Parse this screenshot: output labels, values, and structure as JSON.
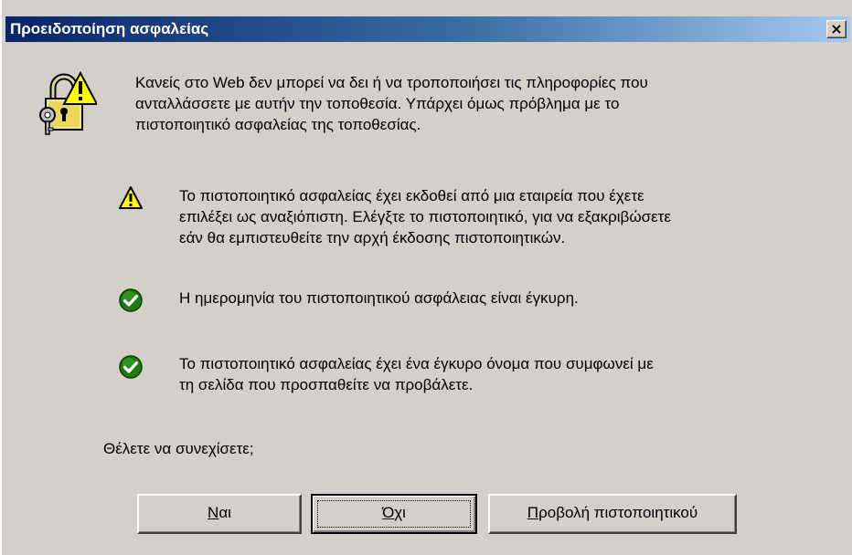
{
  "window": {
    "title": "Προειδοποίηση ασφαλείας",
    "close_glyph": "×"
  },
  "intro": {
    "line1": "Κανείς στο Web δεν μπορεί να δει ή να τροποποιήσει τις πληροφορίες που",
    "line2": "ανταλλάσσετε με αυτήν την τοποθεσία. Υπάρχει όμως πρόβλημα με το",
    "line3": "πιστοποιητικό ασφαλείας της τοποθεσίας."
  },
  "checks": [
    {
      "status": "warning",
      "icon": "warning-triangle-icon",
      "lines": [
        "Το πιστοποιητικό ασφαλείας έχει εκδοθεί από μια εταιρεία που έχετε",
        "επιλέξει ως αναξιόπιστη. Ελέγξτε το πιστοποιητικό, για να εξακριβώσετε",
        "εάν θα εμπιστευθείτε την αρχή έκδοσης πιστοποιητικών."
      ]
    },
    {
      "status": "ok",
      "icon": "checkmark-circle-icon",
      "lines": [
        "Η ημερομηνία του πιστοποιητικού ασφάλειας είναι έγκυρη."
      ]
    },
    {
      "status": "ok",
      "icon": "checkmark-circle-icon",
      "lines": [
        "Το πιστοποιητικό ασφαλείας έχει ένα έγκυρο όνομα που συμφωνεί με",
        "τη σελίδα που προσπαθείτε να προβάλετε."
      ]
    }
  ],
  "question": "Θέλετε να συνεχίσετε;",
  "buttons": {
    "yes": {
      "accel": "Ν",
      "rest": "αι"
    },
    "no": {
      "accel": "Ό",
      "rest": "χι"
    },
    "view": {
      "accel": "Π",
      "rest": "ροβολή πιστοποιητικού"
    }
  },
  "colors": {
    "dialog_bg": "#d4d0c8",
    "title_start": "#0a246a",
    "title_end": "#a6caf0",
    "warning_yellow": "#ffff00",
    "ok_green": "#2e8b1e"
  }
}
